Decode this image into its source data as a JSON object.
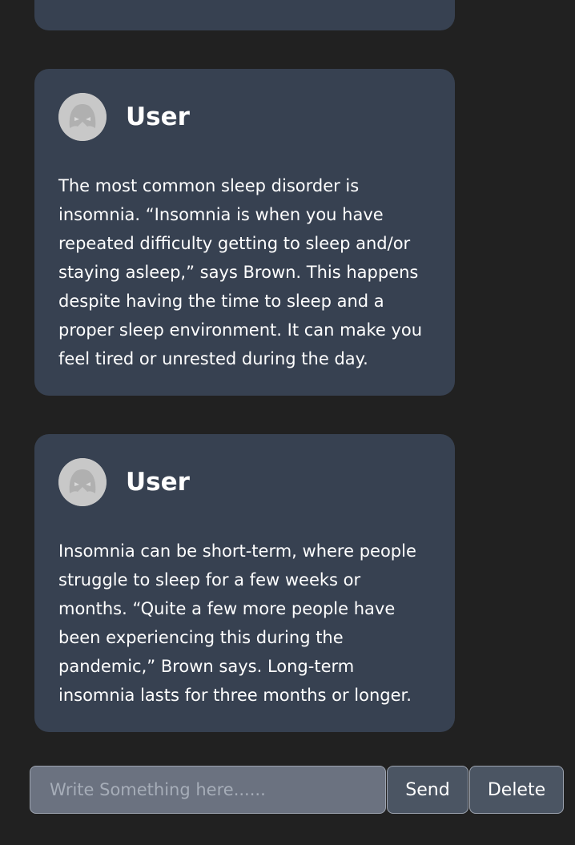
{
  "messages": [
    {
      "user": "User",
      "avatar_icon": "anime-avatar-icon",
      "text": "The most common sleep disorder is insomnia. “Insomnia is when you have repeated difficulty getting to sleep and/or staying asleep,” says Brown. This happens despite having the time to sleep and a proper sleep environment. It can make you feel tired or unrested during the day."
    },
    {
      "user": "User",
      "avatar_icon": "anime-avatar-icon",
      "text": "Insomnia can be short-term, where people struggle to sleep for a few weeks or months. “Quite a few more people have been experiencing this during the pandemic,” Brown says. Long-term insomnia lasts for three months or longer."
    }
  ],
  "composer": {
    "placeholder": "Write Something here......",
    "value": "",
    "send_label": "Send",
    "delete_label": "Delete"
  },
  "colors": {
    "background": "#212121",
    "card": "#374151",
    "input": "#6b7280",
    "button": "#4b5563"
  }
}
